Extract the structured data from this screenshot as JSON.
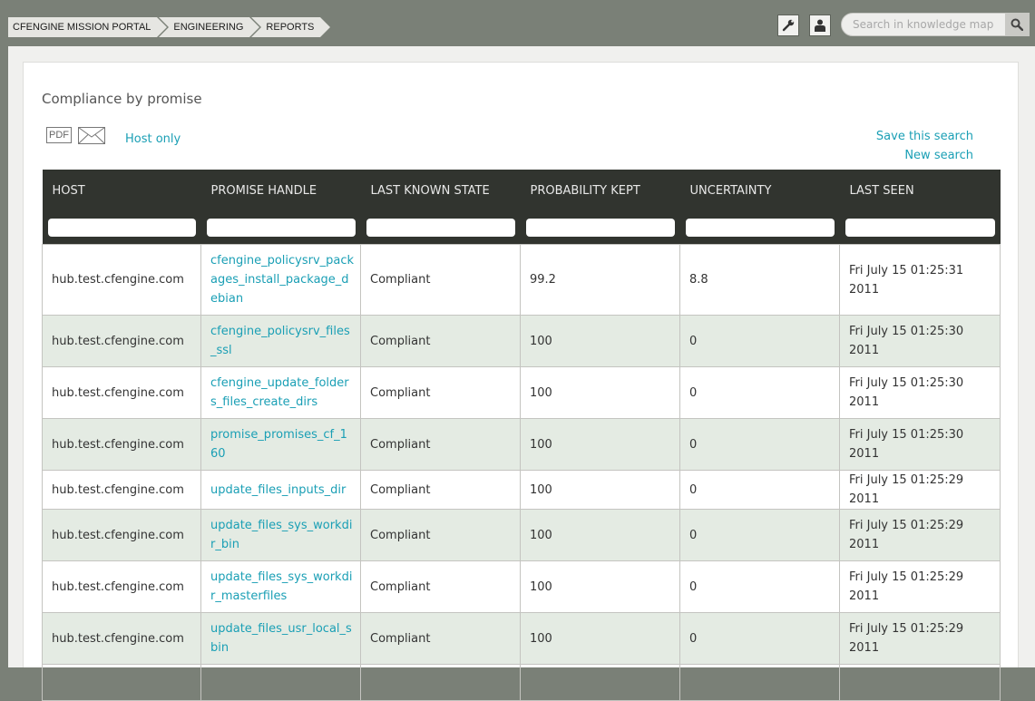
{
  "breadcrumb": [
    "CFENGINE MISSION PORTAL",
    "ENGINEERING",
    "REPORTS"
  ],
  "search": {
    "placeholder": "Search in knowledge map"
  },
  "page": {
    "title": "Compliance by promise",
    "pdf_label": "PDF",
    "host_only": "Host only",
    "save_search": "Save this search",
    "new_search": "New search"
  },
  "table": {
    "columns": [
      "HOST",
      "PROMISE HANDLE",
      "LAST KNOWN STATE",
      "PROBABILITY KEPT",
      "UNCERTAINTY",
      "LAST SEEN"
    ],
    "rows": [
      {
        "host": "hub.test.cfengine.com",
        "handle": "cfengine_policysrv_packages_install_package_debian",
        "state": "Compliant",
        "prob": "99.2",
        "unc": "8.8",
        "seen": "Fri July 15 01:25:31 2011"
      },
      {
        "host": "hub.test.cfengine.com",
        "handle": "cfengine_policysrv_files_ssl",
        "state": "Compliant",
        "prob": "100",
        "unc": "0",
        "seen": "Fri July 15 01:25:30 2011"
      },
      {
        "host": "hub.test.cfengine.com",
        "handle": "cfengine_update_folders_files_create_dirs",
        "state": "Compliant",
        "prob": "100",
        "unc": "0",
        "seen": "Fri July 15 01:25:30 2011"
      },
      {
        "host": "hub.test.cfengine.com",
        "handle": "promise_promises_cf_160",
        "state": "Compliant",
        "prob": "100",
        "unc": "0",
        "seen": "Fri July 15 01:25:30 2011"
      },
      {
        "host": "hub.test.cfengine.com",
        "handle": "update_files_inputs_dir",
        "state": "Compliant",
        "prob": "100",
        "unc": "0",
        "seen": "Fri July 15 01:25:29 2011"
      },
      {
        "host": "hub.test.cfengine.com",
        "handle": "update_files_sys_workdir_bin",
        "state": "Compliant",
        "prob": "100",
        "unc": "0",
        "seen": "Fri July 15 01:25:29 2011"
      },
      {
        "host": "hub.test.cfengine.com",
        "handle": "update_files_sys_workdir_masterfiles",
        "state": "Compliant",
        "prob": "100",
        "unc": "0",
        "seen": "Fri July 15 01:25:29 2011"
      },
      {
        "host": "hub.test.cfengine.com",
        "handle": "update_files_usr_local_sbin",
        "state": "Compliant",
        "prob": "100",
        "unc": "0",
        "seen": "Fri July 15 01:25:29 2011"
      }
    ]
  }
}
